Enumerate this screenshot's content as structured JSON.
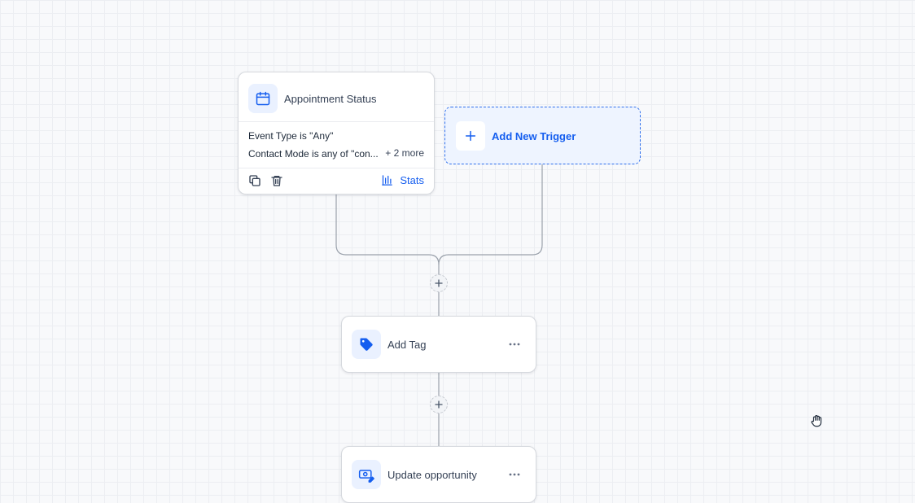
{
  "colors": {
    "accent": "#155eef",
    "canvas": "#f8f9fb",
    "grid": "#eceef2",
    "connector": "#9aa1ab",
    "icon_bg": "#eaf1ff"
  },
  "trigger": {
    "title": "Appointment Status",
    "icon": "calendar-icon",
    "filters": [
      "Event Type is \"Any\"",
      "Contact Mode is any of \"con..."
    ],
    "more": "+ 2 more",
    "stats_label": "Stats",
    "footer_icons": [
      "copy-icon",
      "trash-icon",
      "bar-chart-icon"
    ]
  },
  "add_trigger": {
    "label": "Add New Trigger",
    "icon": "plus-icon"
  },
  "actions": [
    {
      "label": "Add Tag",
      "icon": "tag-icon",
      "menu_icon": "more-horizontal-icon"
    },
    {
      "label": "Update opportunity",
      "icon": "opportunity-icon",
      "menu_icon": "more-horizontal-icon"
    }
  ],
  "add_step_icon": "plus-icon",
  "cursor_icon": "hand-grab-cursor-icon"
}
